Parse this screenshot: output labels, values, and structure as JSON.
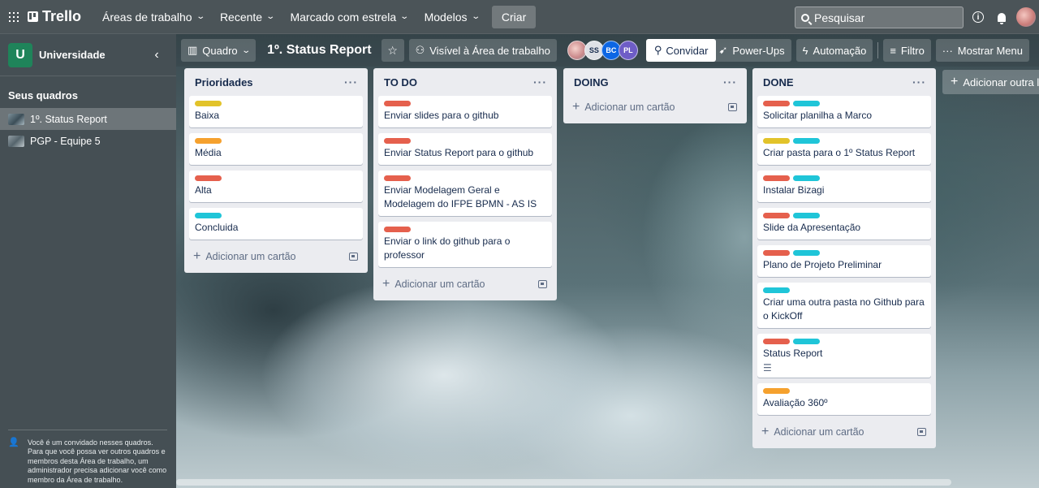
{
  "topbar": {
    "logo": "Trello",
    "nav": [
      {
        "label": "Áreas de trabalho"
      },
      {
        "label": "Recente"
      },
      {
        "label": "Marcado com estrela"
      },
      {
        "label": "Modelos"
      }
    ],
    "create_label": "Criar",
    "search_placeholder": "Pesquisar"
  },
  "sidebar": {
    "workspace_initial": "U",
    "workspace_name": "Universidade",
    "section_title": "Seus quadros",
    "boards": [
      {
        "label": "1º. Status Report",
        "active": true
      },
      {
        "label": "PGP - Equipe 5",
        "active": false
      }
    ],
    "note": "Você é um convidado nesses quadros. Para que você possa ver outros quadros e membros desta Área de trabalho, um administrador precisa adicionar você como membro da Área de trabalho."
  },
  "board": {
    "view_label": "Quadro",
    "title": "1º. Status Report",
    "visibility_label": "Visível à Área de trabalho",
    "members": [
      "",
      "SS",
      "BC",
      "PL"
    ],
    "invite_label": "Convidar",
    "powerups_label": "Power-Ups",
    "automation_label": "Automação",
    "filter_label": "Filtro",
    "menu_label": "Mostrar Menu",
    "add_list_label": "Adicionar outra lista",
    "add_card_label": "Adicionar um cartão"
  },
  "colors": {
    "yellow": "#e2c32a",
    "orange": "#f5a12e",
    "red": "#e5604d",
    "cyan": "#1fc5d8"
  },
  "lists": [
    {
      "title": "Prioridades",
      "cards": [
        {
          "text": "Baixa",
          "labels": [
            "yellow"
          ]
        },
        {
          "text": "Média",
          "labels": [
            "orange"
          ]
        },
        {
          "text": "Alta",
          "labels": [
            "red"
          ]
        },
        {
          "text": "Concluida",
          "labels": [
            "cyan"
          ]
        }
      ]
    },
    {
      "title": "TO DO",
      "cards": [
        {
          "text": "Enviar slides para o github",
          "labels": [
            "red"
          ]
        },
        {
          "text": "Enviar Status Report para o github",
          "labels": [
            "red"
          ]
        },
        {
          "text": "Enviar Modelagem Geral e Modelagem do IFPE BPMN - AS IS",
          "labels": [
            "red"
          ]
        },
        {
          "text": "Enviar o link do github para o professor",
          "labels": [
            "red"
          ]
        }
      ]
    },
    {
      "title": "DOING",
      "cards": []
    },
    {
      "title": "DONE",
      "cards": [
        {
          "text": "Solicitar planilha a Marco",
          "labels": [
            "red",
            "cyan"
          ]
        },
        {
          "text": "Criar pasta para o 1º Status Report",
          "labels": [
            "yellow",
            "cyan"
          ]
        },
        {
          "text": "Instalar Bizagi",
          "labels": [
            "red",
            "cyan"
          ]
        },
        {
          "text": "Slide da Apresentação",
          "labels": [
            "red",
            "cyan"
          ]
        },
        {
          "text": "Plano de Projeto Preliminar",
          "labels": [
            "red",
            "cyan"
          ]
        },
        {
          "text": "Criar uma outra pasta no Github para o KickOff",
          "labels": [
            "cyan"
          ]
        },
        {
          "text": "Status Report",
          "labels": [
            "red",
            "cyan"
          ],
          "has_description": true
        },
        {
          "text": "Avaliação 360º",
          "labels": [
            "orange"
          ]
        }
      ]
    }
  ]
}
